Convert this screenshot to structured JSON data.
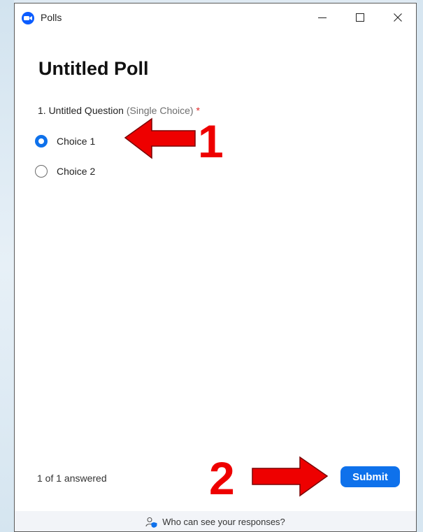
{
  "window": {
    "title": "Polls",
    "app_icon": "zoom-logo-icon",
    "controls": [
      "minimize-icon",
      "maximize-icon",
      "close-icon"
    ]
  },
  "poll": {
    "title": "Untitled Poll",
    "question": {
      "number_text": "1. Untitled Question",
      "type_text": "(Single Choice)",
      "required_marker": "*"
    },
    "choices": [
      {
        "label": "Choice 1",
        "selected": true
      },
      {
        "label": "Choice 2",
        "selected": false
      }
    ]
  },
  "footer": {
    "answered_text": "1 of 1 answered",
    "submit_label": "Submit",
    "privacy_link": "Who can see your responses?",
    "privacy_icon": "person-shield-icon"
  },
  "annotations": {
    "step1": "1",
    "step2": "2",
    "arrow_color": "#ee0000"
  },
  "colors": {
    "accent": "#0e71eb",
    "required": "#e02828"
  }
}
